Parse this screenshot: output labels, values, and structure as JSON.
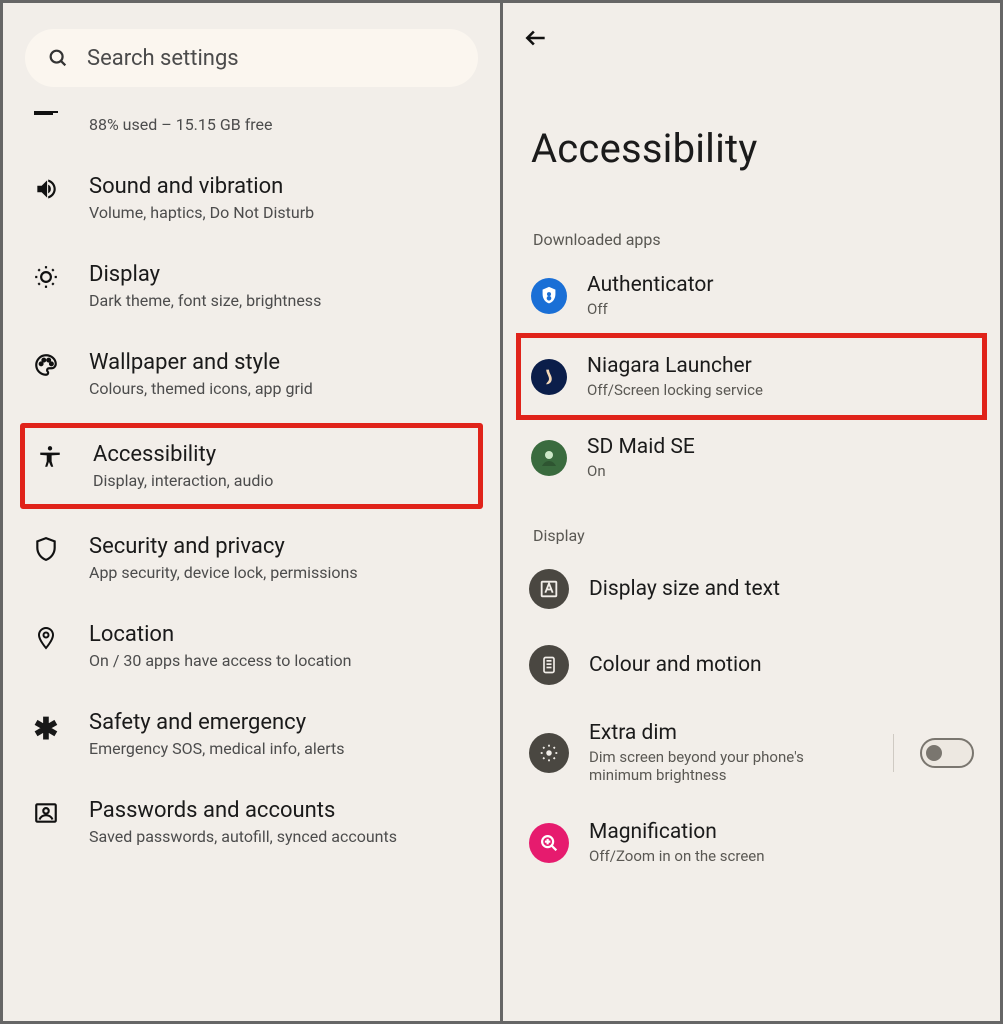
{
  "left": {
    "search_placeholder": "Search settings",
    "storage": {
      "sub": "88% used – 15.15 GB free"
    },
    "items": [
      {
        "title": "Sound and vibration",
        "sub": "Volume, haptics, Do Not Disturb"
      },
      {
        "title": "Display",
        "sub": "Dark theme, font size, brightness"
      },
      {
        "title": "Wallpaper and style",
        "sub": "Colours, themed icons, app grid"
      },
      {
        "title": "Accessibility",
        "sub": "Display, interaction, audio"
      },
      {
        "title": "Security and privacy",
        "sub": "App security, device lock, permissions"
      },
      {
        "title": "Location",
        "sub": "On / 30 apps have access to location"
      },
      {
        "title": "Safety and emergency",
        "sub": "Emergency SOS, medical info, alerts"
      },
      {
        "title": "Passwords and accounts",
        "sub": "Saved passwords, autofill, synced accounts"
      }
    ]
  },
  "right": {
    "page_title": "Accessibility",
    "sections": {
      "downloaded": "Downloaded apps",
      "display": "Display"
    },
    "apps": [
      {
        "title": "Authenticator",
        "sub": "Off"
      },
      {
        "title": "Niagara Launcher",
        "sub": "Off/Screen locking service"
      },
      {
        "title": "SD Maid SE",
        "sub": "On"
      }
    ],
    "display_items": [
      {
        "title": "Display size and text"
      },
      {
        "title": "Colour and motion"
      },
      {
        "title": "Extra dim",
        "sub": "Dim screen beyond your phone's minimum brightness",
        "toggle": "off"
      },
      {
        "title": "Magnification",
        "sub": "Off/Zoom in on the screen"
      }
    ]
  }
}
